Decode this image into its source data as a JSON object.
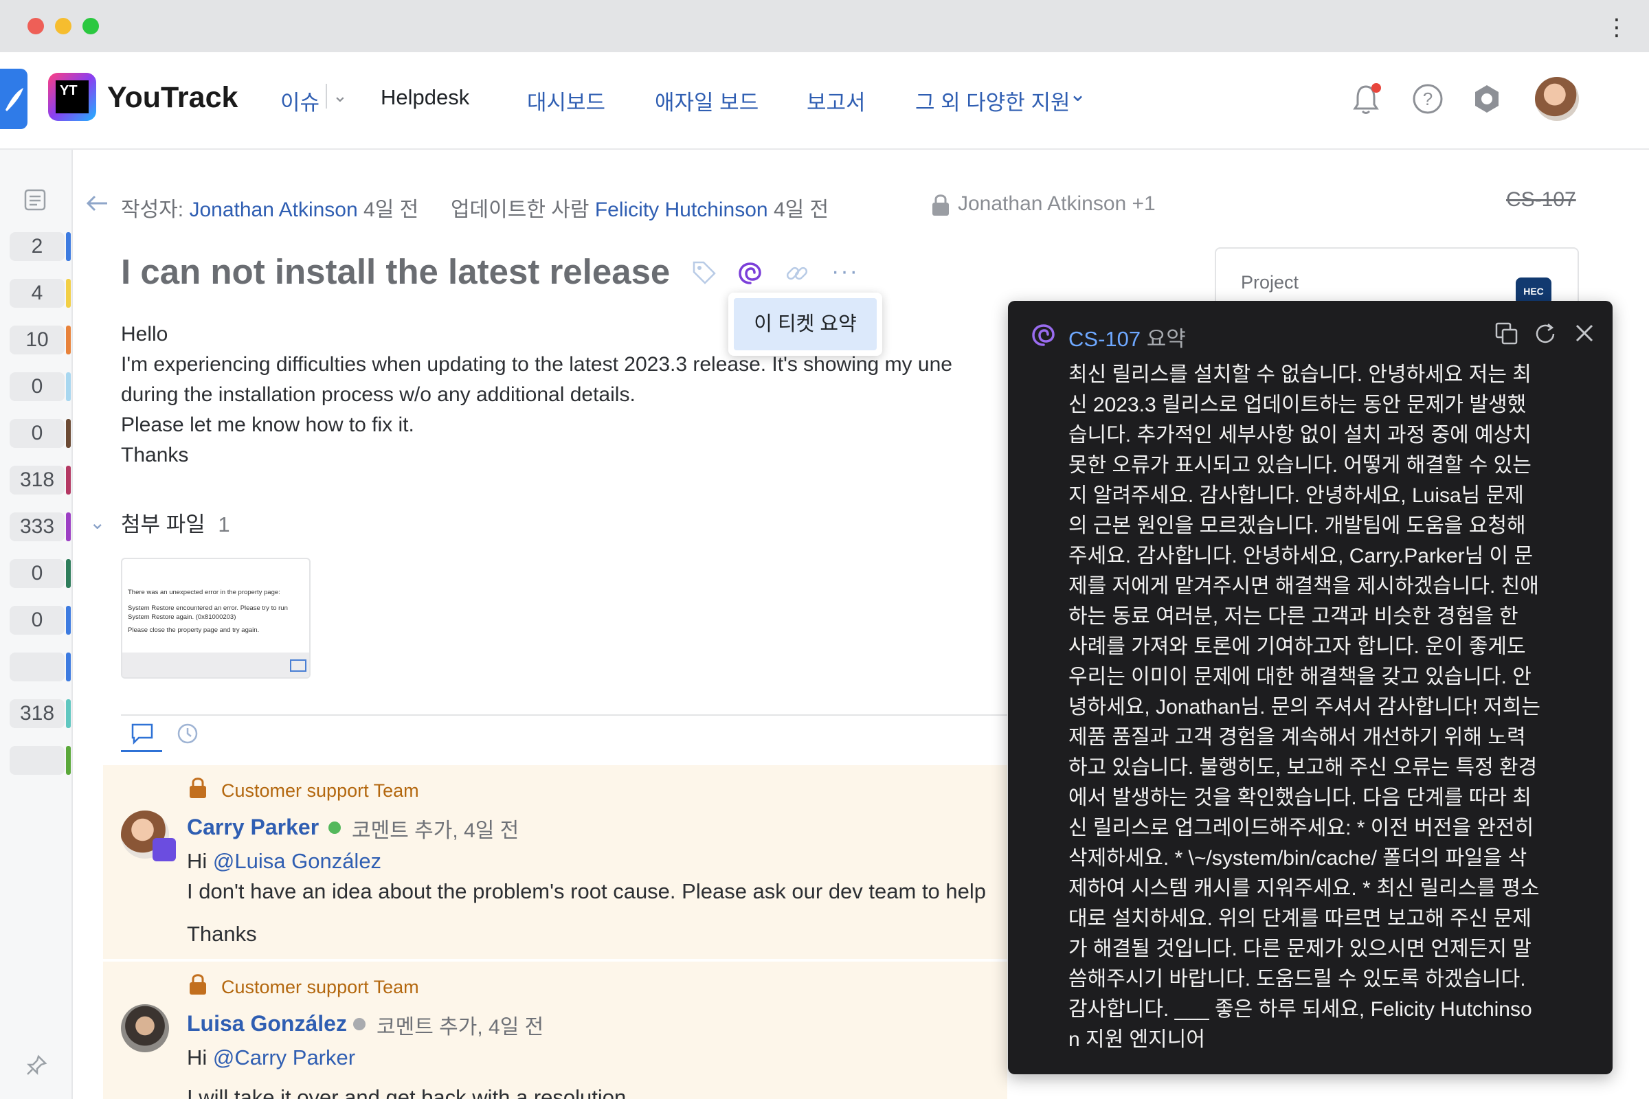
{
  "nav": {
    "brand": "YouTrack",
    "brand_badge": "YT",
    "links": [
      "이슈",
      "Helpdesk",
      "대시보드",
      "애자일 보드",
      "보고서",
      "그 외 다양한 지원"
    ]
  },
  "sidebar": {
    "counts": [
      "2",
      "4",
      "10",
      "0",
      "0",
      "318",
      "333",
      "0",
      "0",
      "",
      "318",
      ""
    ]
  },
  "issue": {
    "author_label": "작성자:",
    "author": "Jonathan Atkinson",
    "author_time": "4일 전",
    "updated_label": "업데이트한 사람",
    "updater": "Felicity Hutchinson",
    "updater_time": "4일 전",
    "visibility": "Jonathan Atkinson +1",
    "id": "CS-107",
    "title": "I can not install the latest release",
    "menu_item": "이 티켓 요약",
    "body": [
      "Hello",
      "I'm experiencing difficulties when updating to the latest 2023.3 release. It's showing my une",
      "during the installation process w/o any additional details.",
      "Please let me know how to fix it.",
      "Thanks"
    ],
    "attachments_label": "첨부 파일",
    "attachments_count": "1",
    "thumb_lines": [
      "There was an unexpected error in the property page:",
      "System Restore encountered an error. Please try to run System Restore again. (0x81000203)",
      "Please close the property page and try again."
    ],
    "project_label": "Project",
    "project_badge": "HEC"
  },
  "comments": [
    {
      "team": "Customer support Team",
      "author": "Carry Parker",
      "meta": "코멘트 추가, 4일 전",
      "mention_prefix": "Hi",
      "mention": "@Luisa González",
      "lines": [
        "I don't have an idea about the problem's root cause. Please ask our dev team to help",
        "Thanks"
      ],
      "status_color": "#54b85b"
    },
    {
      "team": "Customer support Team",
      "author": "Luisa González",
      "meta": "코멘트 추가, 4일 전",
      "mention_prefix": "Hi",
      "mention": "@Carry Parker",
      "lines": [
        "I will take it over and get back with a resolution"
      ],
      "status_color": "#a9abaf"
    }
  ],
  "summary": {
    "id": "CS-107",
    "label": "요약",
    "text": "최신 릴리스를 설치할 수 없습니다. 안녕하세요 저는 최신 2023.3 릴리스로 업데이트하는 동안 문제가 발생했습니다. 추가적인 세부사항 없이 설치 과정 중에 예상치 못한 오류가 표시되고 있습니다. 어떻게 해결할 수 있는지 알려주세요. 감사합니다. 안녕하세요, Luisa님 문제의 근본 원인을 모르겠습니다. 개발팀에 도움을 요청해주세요. 감사합니다. 안녕하세요, Carry.Parker님 이 문제를 저에게 맡겨주시면 해결책을 제시하겠습니다. 친애하는 동료 여러분, 저는 다른 고객과 비슷한 경험을 한 사례를 가져와 토론에 기여하고자 합니다. 운이 좋게도 우리는 이미이 문제에 대한 해결책을 갖고 있습니다. 안녕하세요, Jonathan님. 문의 주셔서 감사합니다! 저희는 제품 품질과 고객 경험을 계속해서 개선하기 위해 노력하고 있습니다. 불행히도, 보고해 주신 오류는 특정 환경에서 발생하는 것을 확인했습니다. 다음 단계를 따라 최신 릴리스로 업그레이드해주세요: * 이전 버전을 완전히 삭제하세요. * \\~/system/bin/cache/ 폴더의 파일을 삭제하여 시스템 캐시를 지워주세요. * 최신 릴리스를 평소대로 설치하세요. 위의 단계를 따르면 보고해 주신 문제가 해결될 것입니다. 다른 문제가 있으시면 언제든지 말씀해주시기 바랍니다. 도움드릴 수 있도록 하겠습니다. 감사합니다. ___ 좋은 하루 되세요, Felicity Hutchinson 지원 엔지니어"
  },
  "colors": {
    "accent": "#2f5eb2",
    "ai": "#7b3fd9",
    "popup_bg": "#1d1d1f",
    "comment_bg": "#fdf6ea",
    "team_label": "#b3670e"
  }
}
